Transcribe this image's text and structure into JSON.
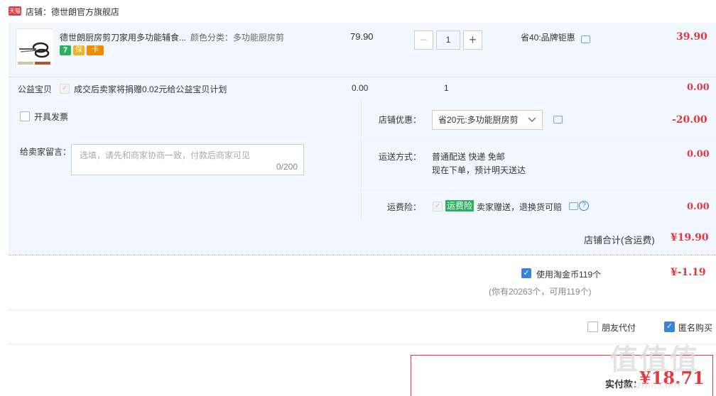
{
  "shop": {
    "badge": "天猫",
    "label": "店铺：德世朗官方旗舰店"
  },
  "item": {
    "title": "德世朗厨房剪刀家用多功能辅食...",
    "sku": "颜色分类：多功能厨房剪",
    "price": "79.90",
    "quantity": "1",
    "promo": "省40:品牌钜惠",
    "subtotal": "39.90",
    "badges": [
      "7",
      "保",
      "卡"
    ]
  },
  "charity": {
    "label": "公益宝贝",
    "text": "成交后卖家将捐赠0.02元给公益宝贝计划",
    "price": "0.00",
    "qty": "1",
    "amount": "0.00"
  },
  "invoice": {
    "label": "开具发票"
  },
  "message": {
    "label": "给卖家留言：",
    "placeholder": "选填，请先和商家协商一致，付款后商家可见",
    "counter": "0/200"
  },
  "shop_discount": {
    "label": "店铺优惠：",
    "selected": "省20元:多功能厨房剪",
    "amount": "-20.00"
  },
  "shipping": {
    "label": "运送方式：",
    "method": "普通配送 快递 免邮",
    "eta": "现在下单，预计明天送达",
    "amount": "0.00"
  },
  "insurance": {
    "label": "运费险：",
    "tag": "运费险",
    "text": "卖家赠送，退换货可赔",
    "amount": "0.00"
  },
  "shop_total": {
    "label": "店铺合计(含运费)",
    "amount": "¥19.90"
  },
  "coins": {
    "label": "使用淘金币119个",
    "note": "(你有20263个，可用119个)",
    "amount": "¥-1.19"
  },
  "options": {
    "friend_pay": "朋友代付",
    "anonymous": "匿名购买"
  },
  "pay": {
    "label": "实付款：",
    "amount": "¥18.71"
  },
  "watermark": {
    "logo": "值值值",
    "site": "smzdm.com"
  },
  "colors": {
    "accent_red": "#e4393c",
    "panel_bg": "#f2f7ff",
    "check_blue": "#3a83dd",
    "insurance_green": "#2ab15d"
  }
}
